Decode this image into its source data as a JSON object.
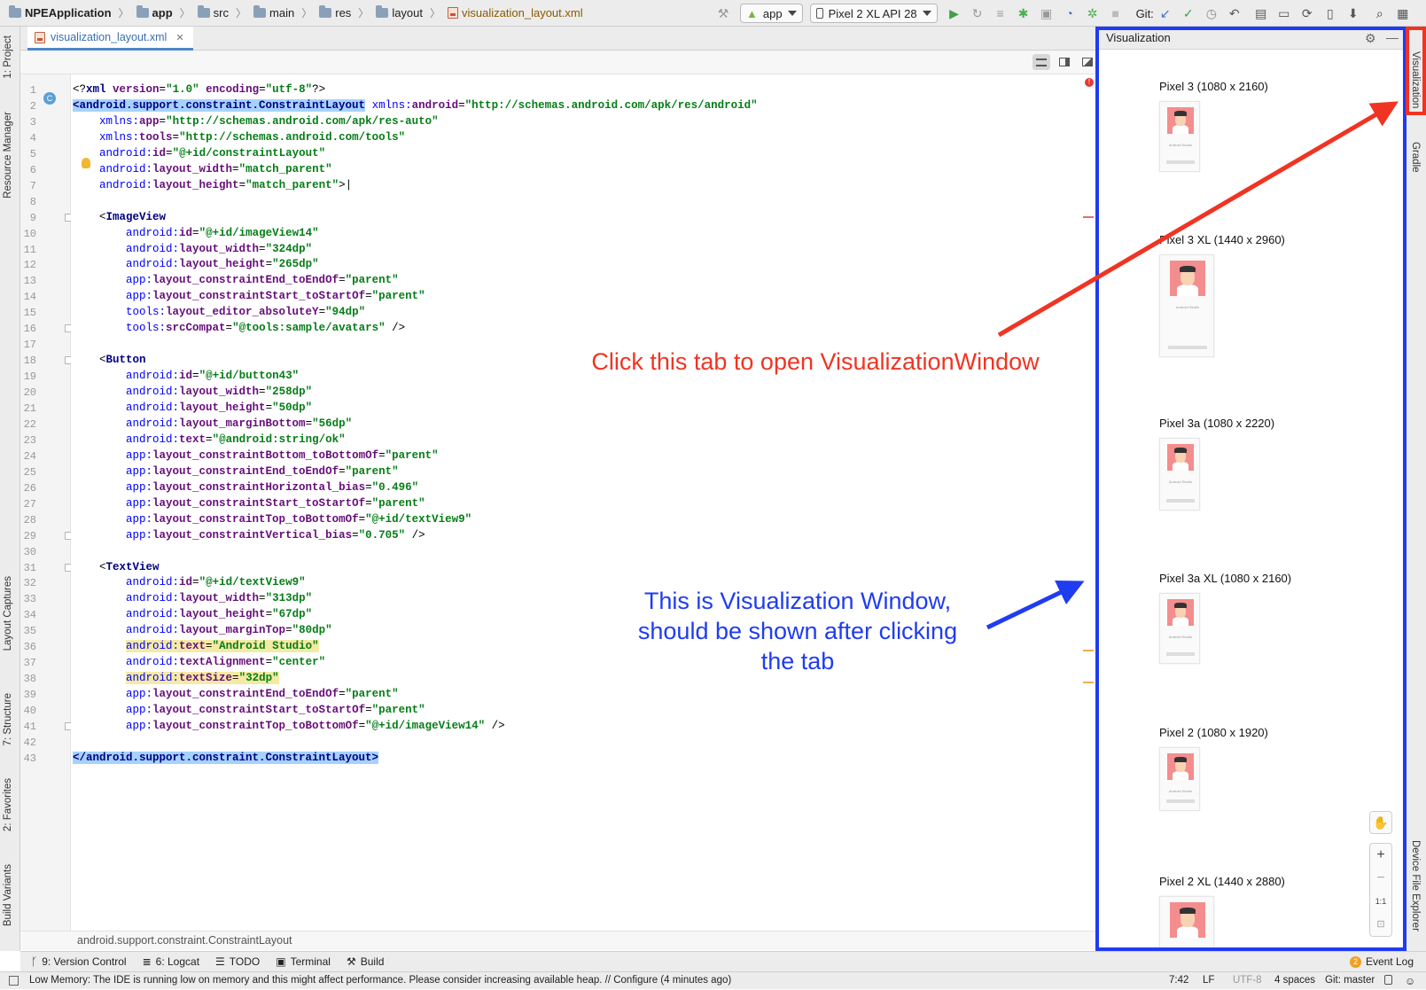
{
  "navbar": {
    "crumbs": [
      "NPEApplication",
      "app",
      "src",
      "main",
      "res",
      "layout",
      "visualization_layout.xml"
    ],
    "run_config": "app",
    "device": "Pixel 2 XL API 28",
    "git_label": "Git:"
  },
  "left_tabs": [
    "1: Project",
    "Resource Manager",
    "Layout Captures",
    "7: Structure",
    "2: Favorites",
    "Build Variants"
  ],
  "right_tabs": [
    "Visualization",
    "Gradle",
    "Device File Explorer"
  ],
  "editor": {
    "tab_label": "visualization_layout.xml",
    "breadcrumb": "android.support.constraint.ConstraintLayout",
    "line_numbers": [
      "1",
      "2",
      "3",
      "4",
      "5",
      "6",
      "7",
      "8",
      "9",
      "10",
      "11",
      "12",
      "13",
      "14",
      "15",
      "16",
      "17",
      "18",
      "19",
      "20",
      "21",
      "22",
      "23",
      "24",
      "25",
      "26",
      "27",
      "28",
      "29",
      "30",
      "31",
      "32",
      "33",
      "34",
      "35",
      "36",
      "37",
      "38",
      "39",
      "40",
      "41",
      "42",
      "43"
    ]
  },
  "visualization": {
    "title": "Visualization",
    "devices": [
      {
        "label": "Pixel 3 (1080 x 2160)"
      },
      {
        "label": "Pixel 3 XL (1440 x 2960)"
      },
      {
        "label": "Pixel 3a (1080 x 2220)"
      },
      {
        "label": "Pixel 3a XL (1080 x 2160)"
      },
      {
        "label": "Pixel 2 (1080 x 1920)"
      },
      {
        "label": "Pixel 2 XL (1440 x 2880)"
      }
    ],
    "preview_text": "Android Studio",
    "zoom_reset": "1:1"
  },
  "annotations": {
    "red": "Click this tab to open VisualizationWindow",
    "blue_line1": "This is Visualization Window,",
    "blue_line2": "should be shown after clicking",
    "blue_line3": "the tab",
    "red_color": "#f03423",
    "blue_color": "#1f3cf0"
  },
  "bottom_tools": [
    "9: Version Control",
    "6: Logcat",
    "TODO",
    "Terminal",
    "Build"
  ],
  "event_log": {
    "label": "Event Log",
    "count": "2"
  },
  "status": {
    "message": "Low Memory: The IDE is running low on memory and this might affect performance. Please consider increasing available heap. // Configure (4 minutes ago)",
    "position": "7:42",
    "line_sep": "LF",
    "encoding": "UTF-8",
    "indent": "4 spaces",
    "branch": "Git: master"
  }
}
